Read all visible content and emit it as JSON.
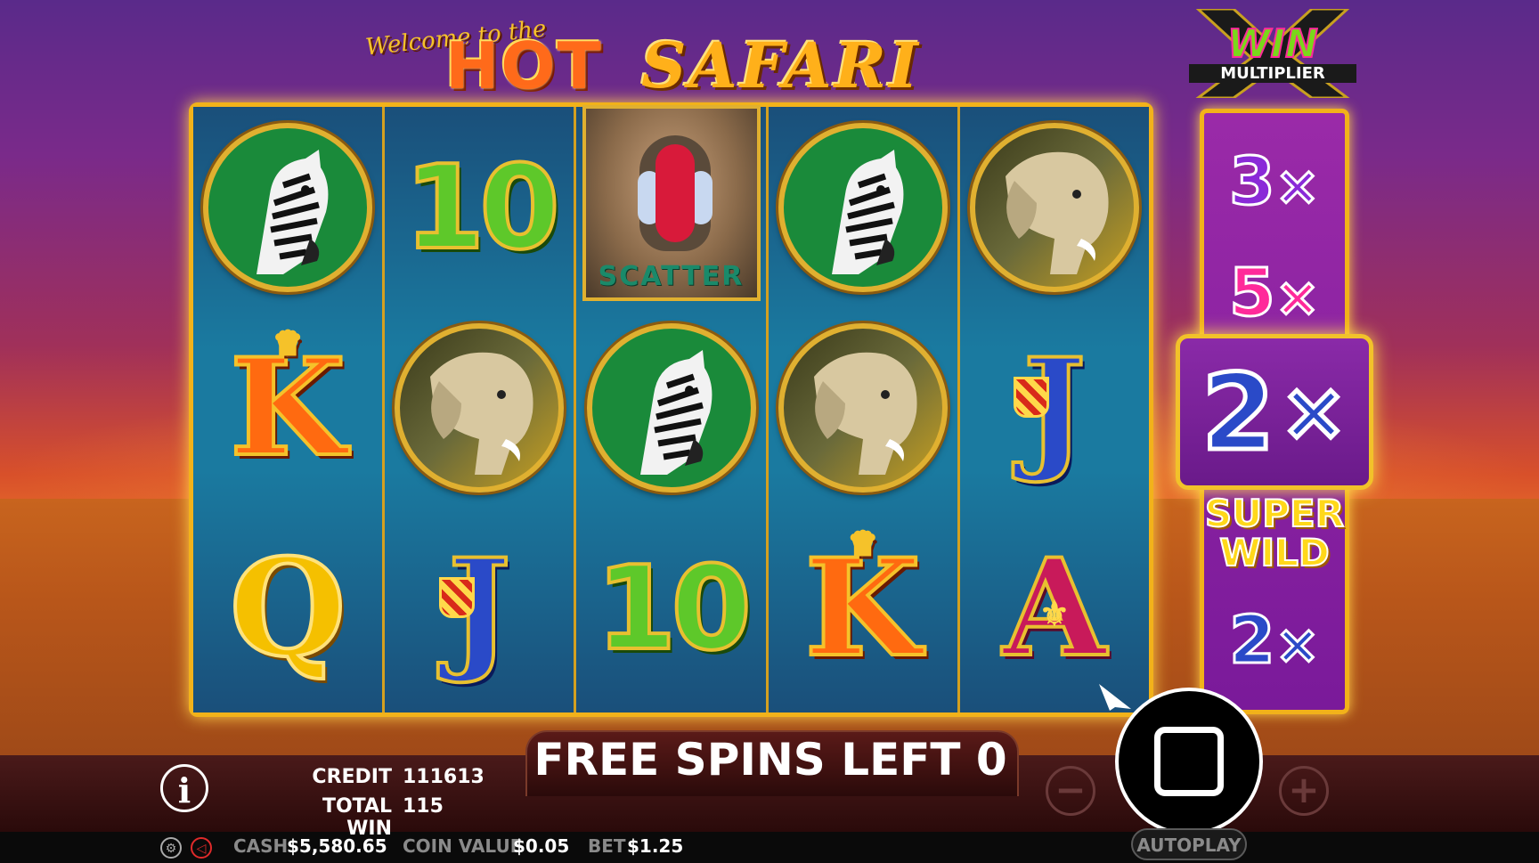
{
  "game": {
    "title_welcome": "Welcome to the",
    "title_hot": "HOT",
    "title_safari": "SAFARI"
  },
  "reels": [
    [
      "zebra",
      "K",
      "Q"
    ],
    [
      "10",
      "elephant",
      "J"
    ],
    [
      "scatter",
      "zebra",
      "10"
    ],
    [
      "zebra",
      "elephant",
      "K"
    ],
    [
      "elephant",
      "J",
      "A"
    ]
  ],
  "symbols": {
    "scatter_label": "SCATTER",
    "ten": "10",
    "k": "K",
    "q": "Q",
    "j": "J",
    "a": "A"
  },
  "win_multiplier": {
    "logo_win": "WIN",
    "logo_multiplier": "MULTIPLIER",
    "values": [
      "3",
      "5",
      "2",
      "2"
    ],
    "x": "×",
    "current": "2",
    "super_wild": "SUPER WILD"
  },
  "free_spins": {
    "label": "FREE SPINS LEFT 0"
  },
  "stats": {
    "credit_label": "CREDIT",
    "credit_value": "111613",
    "total_win_label": "TOTAL WIN",
    "total_win_value": "115"
  },
  "bottom_bar": {
    "cash_label": "CASH",
    "cash_value": "$5,580.65",
    "coin_value_label": "COIN VALUE",
    "coin_value_value": "$0.05",
    "bet_label": "BET",
    "bet_value": "$1.25"
  },
  "controls": {
    "info_label": "i",
    "minus_label": "−",
    "plus_label": "+",
    "autoplay_label": "AUTOPLAY"
  },
  "colors": {
    "frame_gold": "#f2b21a",
    "reel_teal": "#1a7aa0",
    "multiplier_purple": "#9a2aa8"
  }
}
